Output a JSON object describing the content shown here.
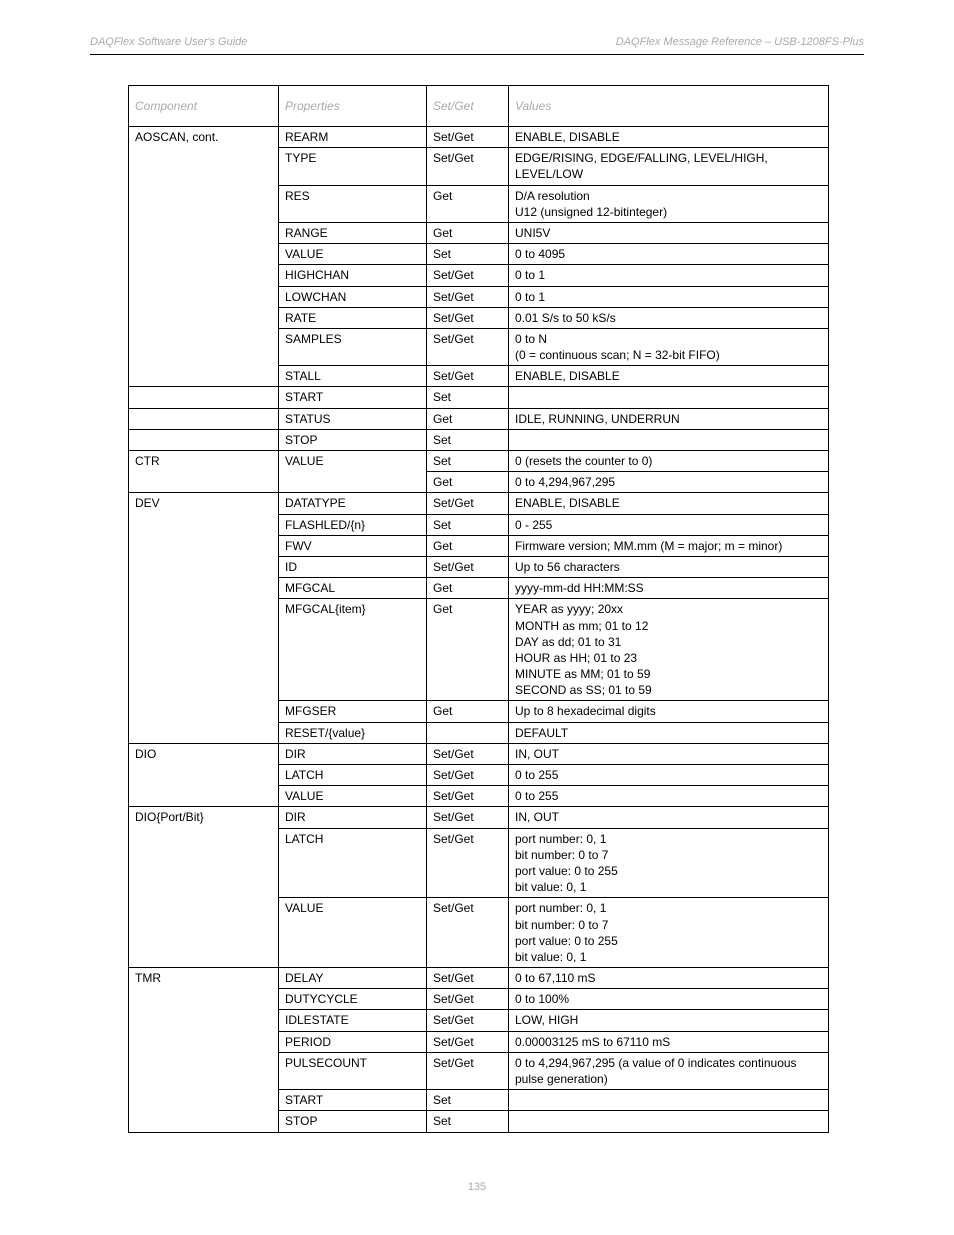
{
  "header": {
    "left": "DAQFlex Software User's Guide",
    "right": "DAQFlex Message Reference – USB-1208FS-Plus"
  },
  "table": {
    "headers": [
      "Component",
      "Properties",
      "Set/Get",
      "Values"
    ],
    "rows": [
      {
        "c1": "AOSCAN, cont.",
        "c2": "REARM",
        "c3": "Set/Get",
        "c4": "ENABLE, DISABLE",
        "span": 10
      },
      {
        "c2": "TYPE",
        "c3": "Set/Get",
        "c4": "EDGE/RISING, EDGE/FALLING, LEVEL/HIGH, LEVEL/LOW"
      },
      {
        "c2": "RES",
        "c3": "Get",
        "c4": "D/A resolution\nU12 (unsigned 12-bitinteger)"
      },
      {
        "c2": "RANGE",
        "c3": "Get",
        "c4": "UNI5V"
      },
      {
        "c2": "VALUE",
        "c3": "Set",
        "c4": "0 to 4095"
      },
      {
        "c2": "HIGHCHAN",
        "c3": "Set/Get",
        "c4": "0 to 1"
      },
      {
        "c2": "LOWCHAN",
        "c3": "Set/Get",
        "c4": "0 to 1"
      },
      {
        "c2": "RATE",
        "c3": "Set/Get",
        "c4": "0.01 S/s to 50 kS/s"
      },
      {
        "c2": "SAMPLES",
        "c3": "Set/Get",
        "c4": "0 to N\n(0 = continuous scan; N = 32-bit FIFO)"
      },
      {
        "c2": "STALL",
        "c3": "Set/Get",
        "c4": "ENABLE, DISABLE"
      },
      {
        "c2": "START",
        "c3": "Set",
        "c4": ""
      },
      {
        "c2": "STATUS",
        "c3": "Get",
        "c4": "IDLE, RUNNING, UNDERRUN"
      },
      {
        "c2": "STOP",
        "c3": "Set",
        "c4": ""
      },
      {
        "c1": "CTR",
        "c2": "VALUE",
        "c2span": 2,
        "c3": "Set",
        "c4": "0 (resets the counter to 0)",
        "span": 2
      },
      {
        "c3": "Get",
        "c4": "0 to 4,294,967,295"
      },
      {
        "c1": "DEV",
        "c2": "DATATYPE",
        "c3": "Set/Get",
        "c4": "ENABLE, DISABLE",
        "span": 8
      },
      {
        "c2": "FLASHLED/{n}",
        "c3": "Set",
        "c4": "0 - 255"
      },
      {
        "c2": "FWV",
        "c3": "Get",
        "c4": "Firmware version; MM.mm (M = major; m = minor)"
      },
      {
        "c2": "ID",
        "c3": "Set/Get",
        "c4": "Up to 56 characters"
      },
      {
        "c2": "MFGCAL",
        "c3": "Get",
        "c4": "yyyy-mm-dd HH:MM:SS"
      },
      {
        "c2": "MFGCAL{item}",
        "c3": "Get",
        "c4": "YEAR as yyyy; 20xx\nMONTH as mm; 01 to 12\nDAY as dd; 01 to 31\nHOUR as HH; 01 to 23\nMINUTE as MM; 01 to 59\nSECOND as SS; 01 to 59"
      },
      {
        "c2": "MFGSER",
        "c3": "Get",
        "c4": "Up to 8 hexadecimal digits"
      },
      {
        "c2": "RESET/{value}",
        "c3": "",
        "c4": "DEFAULT"
      },
      {
        "c1": "DIO",
        "c2": "DIR",
        "c3": "Set/Get",
        "c4": "IN, OUT",
        "span": 3
      },
      {
        "c2": "LATCH",
        "c3": "Set/Get",
        "c4": "0 to 255"
      },
      {
        "c2": "VALUE",
        "c3": "Set/Get",
        "c4": "0 to 255"
      },
      {
        "c1": "DIO{Port/Bit}",
        "c2": "DIR",
        "c3": "Set/Get",
        "c4": "IN, OUT",
        "span": 3
      },
      {
        "c2": "LATCH",
        "c3": "Set/Get",
        "c4": "port number: 0, 1\nbit number: 0 to 7\nport value: 0 to 255\nbit value: 0, 1"
      },
      {
        "c2": "VALUE",
        "c3": "Set/Get",
        "c4": "port number: 0, 1\nbit number: 0 to 7\nport value: 0 to 255\nbit value: 0, 1"
      },
      {
        "c1": "TMR",
        "c2": "DELAY",
        "c3": "Set/Get",
        "c4": "0 to 67,110 mS",
        "span": 7
      },
      {
        "c2": "DUTYCYCLE",
        "c3": "Set/Get",
        "c4": "0 to 100%"
      },
      {
        "c2": "IDLESTATE",
        "c3": "Set/Get",
        "c4": "LOW, HIGH"
      },
      {
        "c2": "PERIOD",
        "c3": "Set/Get",
        "c4": "0.00003125 mS to 67110 mS"
      },
      {
        "c2": "PULSECOUNT",
        "c3": "Set/Get",
        "c4": "0 to 4,294,967,295 (a value of 0 indicates continuous pulse generation)"
      },
      {
        "c2": "START",
        "c3": "Set",
        "c4": ""
      },
      {
        "c2": "STOP",
        "c3": "Set",
        "c4": ""
      }
    ]
  },
  "footer": {
    "page": "135"
  }
}
